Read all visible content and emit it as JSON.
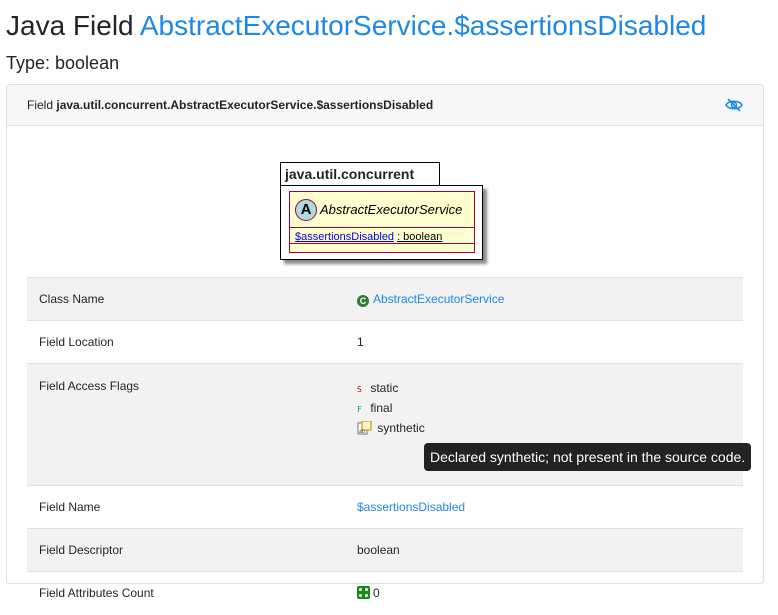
{
  "header": {
    "title_prefix": "Java Field",
    "title_link": "AbstractExecutorService.$assertionsDisabled",
    "type_label": "Type: boolean"
  },
  "card": {
    "header_prefix": "Field",
    "header_name": "java.util.concurrent.AbstractExecutorService.$assertionsDisabled",
    "toggle_icon": "eye-slash-icon"
  },
  "diagram": {
    "package": "java.util.concurrent",
    "class_badge": "A",
    "class_name": "AbstractExecutorService",
    "field_name": "$assertionsDisabled",
    "field_type": ": boolean"
  },
  "details": {
    "class_name_label": "Class Name",
    "class_name_value": "AbstractExecutorService",
    "location_label": "Field Location",
    "location_value": "1",
    "flags_label": "Field Access Flags",
    "flags": [
      {
        "icon": "S",
        "label": "static"
      },
      {
        "icon": "F",
        "label": "final"
      },
      {
        "icon": "synthetic-icon",
        "label": "synthetic"
      }
    ],
    "field_name_label": "Field Name",
    "field_name_value": "$assertionsDisabled",
    "descriptor_label": "Field Descriptor",
    "descriptor_value": "boolean",
    "attr_count_label": "Field Attributes Count",
    "attr_count_value": "0"
  },
  "tooltip": "Declared synthetic; not present in the source code.",
  "colors": {
    "link": "#1e88e5",
    "class_fill": "#fefece",
    "class_border": "#a80036"
  }
}
